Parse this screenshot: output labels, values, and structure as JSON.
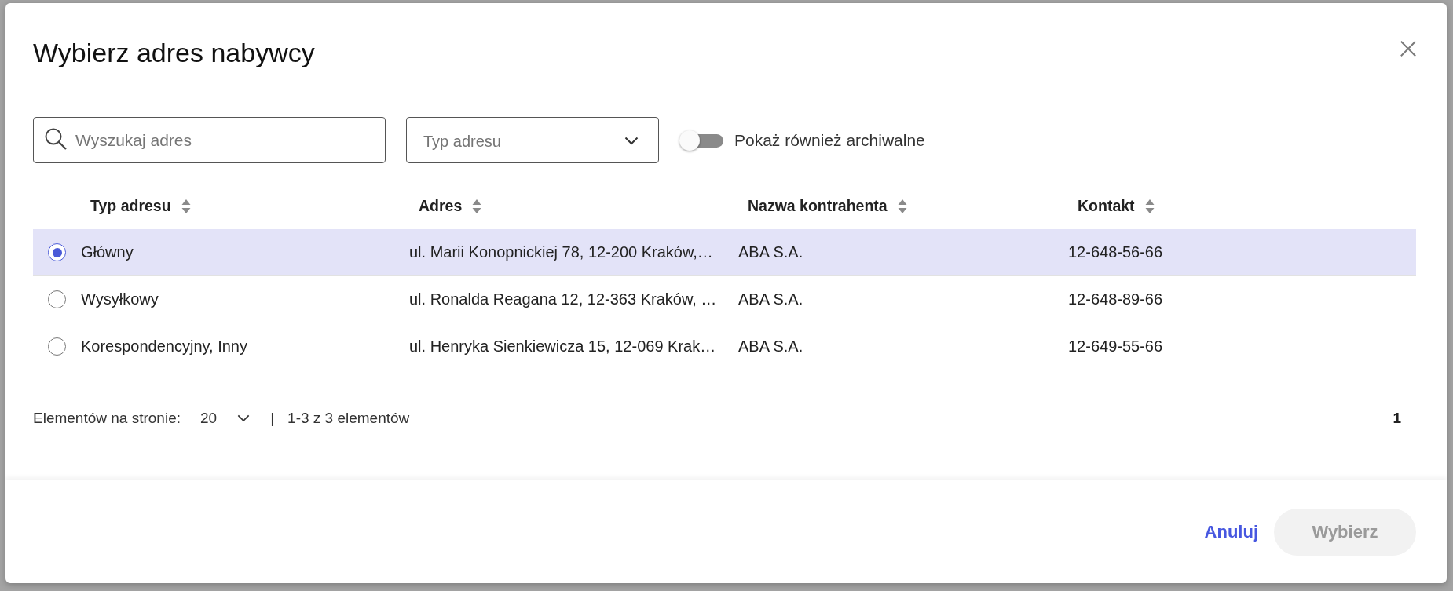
{
  "dialog": {
    "title": "Wybierz adres nabywcy"
  },
  "filters": {
    "search": {
      "placeholder": "Wyszukaj adres"
    },
    "type_select": {
      "placeholder": "Typ adresu"
    },
    "archived_toggle": {
      "label": "Pokaż również archiwalne",
      "on": false
    }
  },
  "table": {
    "columns": [
      {
        "label": "Typ adresu",
        "sortable": true
      },
      {
        "label": "Adres",
        "sortable": true
      },
      {
        "label": "Nazwa kontrahenta",
        "sortable": true
      },
      {
        "label": "Kontakt",
        "sortable": true
      }
    ],
    "rows": [
      {
        "selected": true,
        "cells": [
          "Główny",
          "ul. Marii Konopnickiej 78, 12-200 Kraków,…",
          "ABA S.A.",
          "12-648-56-66"
        ]
      },
      {
        "selected": false,
        "cells": [
          "Wysyłkowy",
          "ul. Ronalda Reagana 12, 12-363 Kraków, …",
          "ABA S.A.",
          "12-648-89-66"
        ]
      },
      {
        "selected": false,
        "cells": [
          "Korespondencyjny, Inny",
          "ul. Henryka Sienkiewicza 15, 12-069 Krak…",
          "ABA S.A.",
          "12-649-55-66"
        ]
      }
    ]
  },
  "pagination": {
    "page_size_label": "Elementów na stronie:",
    "page_size": "20",
    "separator": "|",
    "range": "1-3 z 3 elementów",
    "pages": [
      {
        "label": "1",
        "selected": true
      }
    ]
  },
  "footer": {
    "buttons": [
      {
        "label": "Anuluj",
        "kind": "text",
        "disabled": false
      },
      {
        "label": "Wybierz",
        "kind": "filled",
        "disabled": true
      }
    ]
  }
}
